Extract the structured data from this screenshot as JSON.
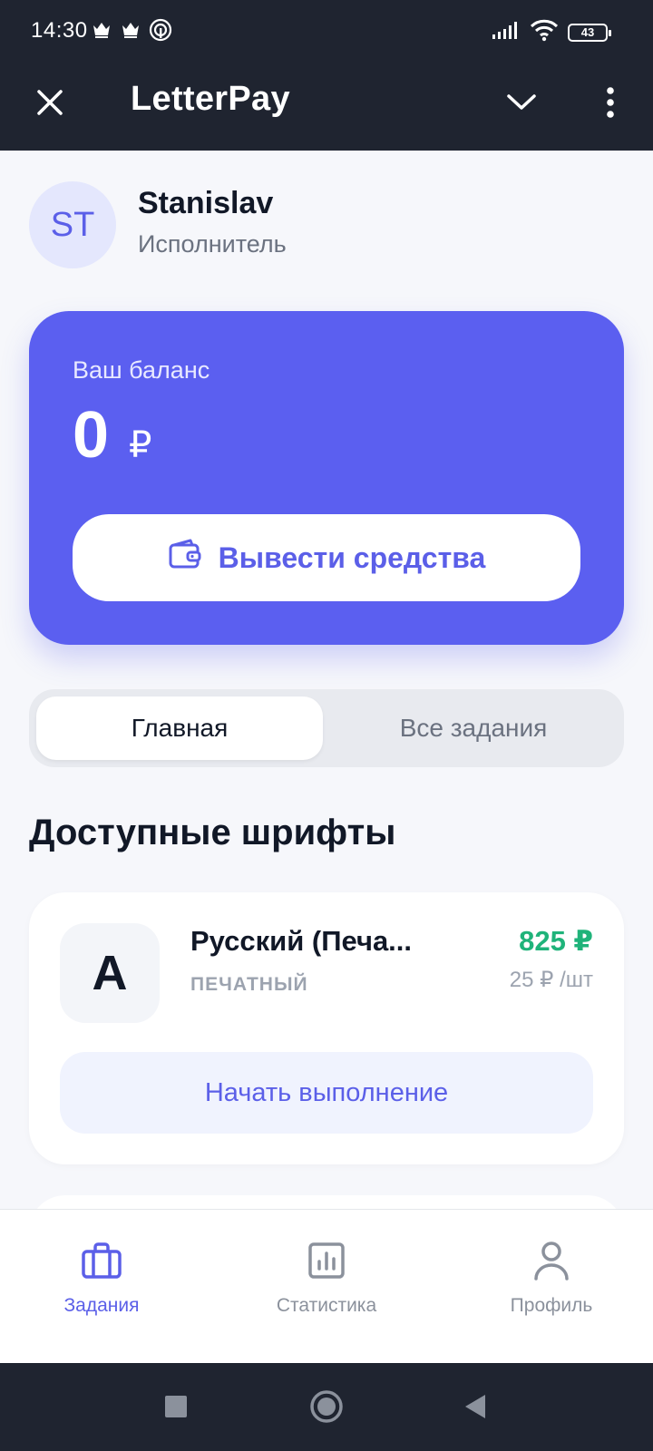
{
  "status_bar": {
    "time": "14:30",
    "battery": "43",
    "icons": [
      "crown-icon",
      "crown-icon",
      "broadcast-icon",
      "signal-icon",
      "wifi-icon",
      "battery-icon"
    ]
  },
  "app_bar": {
    "title": "LetterPay",
    "icons": [
      "close-icon",
      "chevron-down-icon",
      "more-vertical-icon"
    ]
  },
  "profile": {
    "initials": "ST",
    "name": "Stanislav",
    "role": "Исполнитель"
  },
  "balance": {
    "label": "Ваш баланс",
    "value": "0",
    "currency": "₽",
    "withdraw_label": "Вывести средства",
    "withdraw_icon": "wallet-icon"
  },
  "tabs": [
    {
      "label": "Главная",
      "active": true
    },
    {
      "label": "Все задания",
      "active": false
    }
  ],
  "section_title": "Доступные шрифты",
  "fonts": [
    {
      "letter": "A",
      "name": "Русский (Печа...",
      "type": "ПЕЧАТНЫЙ",
      "price": "825 ₽",
      "unit_price": "25 ₽ /шт",
      "action_label": "Начать выполнение"
    }
  ],
  "bottom_nav": [
    {
      "label": "Задания",
      "icon": "briefcase-icon",
      "active": true
    },
    {
      "label": "Статистика",
      "icon": "chart-icon",
      "active": false
    },
    {
      "label": "Профиль",
      "icon": "user-icon",
      "active": false
    }
  ],
  "system_nav": [
    "recents-icon",
    "home-icon",
    "back-icon"
  ],
  "colors": {
    "accent": "#5b5ff0",
    "price_green": "#1fb37a",
    "dark_bar": "#1f2430",
    "background": "#f6f7fb"
  }
}
